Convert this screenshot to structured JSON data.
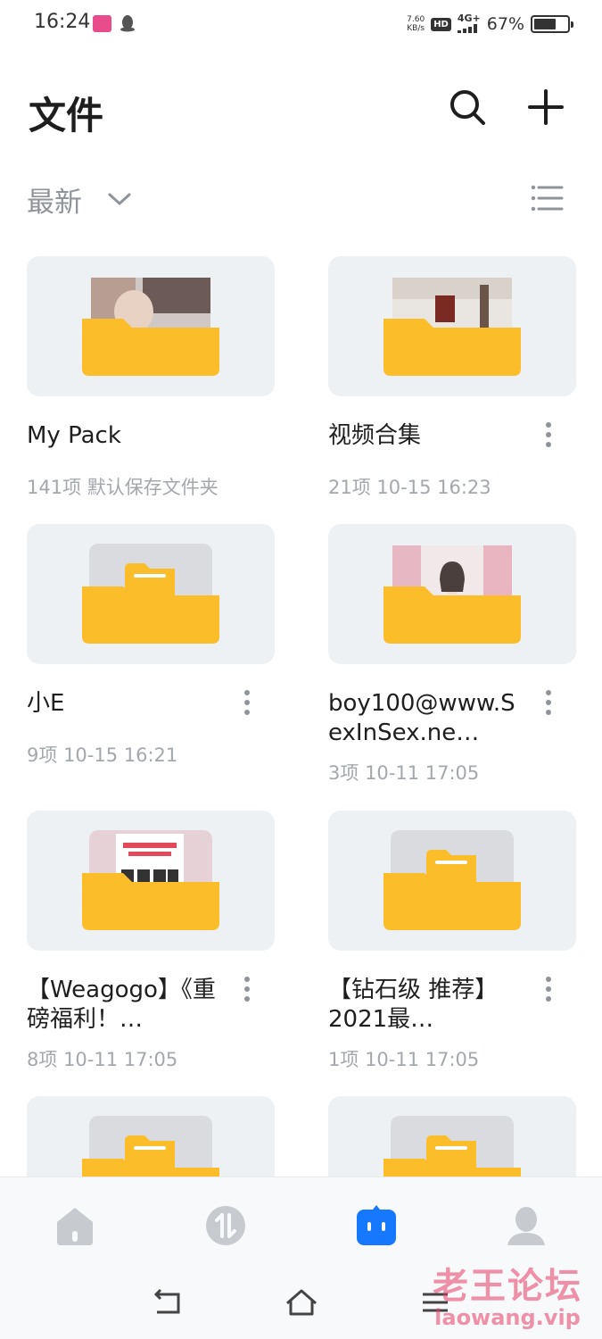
{
  "status_bar": {
    "time": "16:24",
    "speed_value": "7.60",
    "speed_unit": "KB/s",
    "hd_badge": "HD",
    "network": "4G+",
    "battery_text": "67%",
    "battery_level": 0.67
  },
  "header": {
    "title": "文件",
    "search_icon": "search-icon",
    "add_icon": "plus-icon"
  },
  "sort": {
    "label": "最新",
    "chevron_icon": "chevron-down-icon",
    "view_icon": "list-view-icon"
  },
  "folders": [
    {
      "name": "My Pack",
      "count": "141项",
      "detail": "默认保存文件夹",
      "has_menu": false,
      "preview": "photo"
    },
    {
      "name": "视频合集",
      "count": "21项",
      "detail": "10-15 16:23",
      "has_menu": true,
      "preview": "photo"
    },
    {
      "name": "小E",
      "count": "9项",
      "detail": "10-15 16:21",
      "has_menu": true,
      "preview": "empty"
    },
    {
      "name": "boy100@www.SexInSex.ne…",
      "count": "3项",
      "detail": "10-11 17:05",
      "has_menu": true,
      "preview": "photo"
    },
    {
      "name": "【Weagogo】《重磅福利！…",
      "count": "8项",
      "detail": "10-11 17:05",
      "has_menu": true,
      "preview": "poster"
    },
    {
      "name": "【钻石级 推荐】2021最…",
      "count": "1项",
      "detail": "10-11 17:05",
      "has_menu": true,
      "preview": "empty"
    },
    {
      "preview": "empty"
    },
    {
      "preview": "empty"
    }
  ],
  "tab_bar": {
    "tabs": [
      {
        "icon": "home-icon",
        "active": false
      },
      {
        "icon": "transfer-icon",
        "active": false
      },
      {
        "icon": "files-icon",
        "active": true
      },
      {
        "icon": "profile-icon",
        "active": false
      }
    ]
  },
  "colors": {
    "folder_yellow": "#fcbd2a",
    "active_blue": "#1677ff",
    "inactive_gray": "#c7cbcf"
  },
  "watermark": {
    "main": "老王论坛",
    "sub": "laowang.vip"
  }
}
